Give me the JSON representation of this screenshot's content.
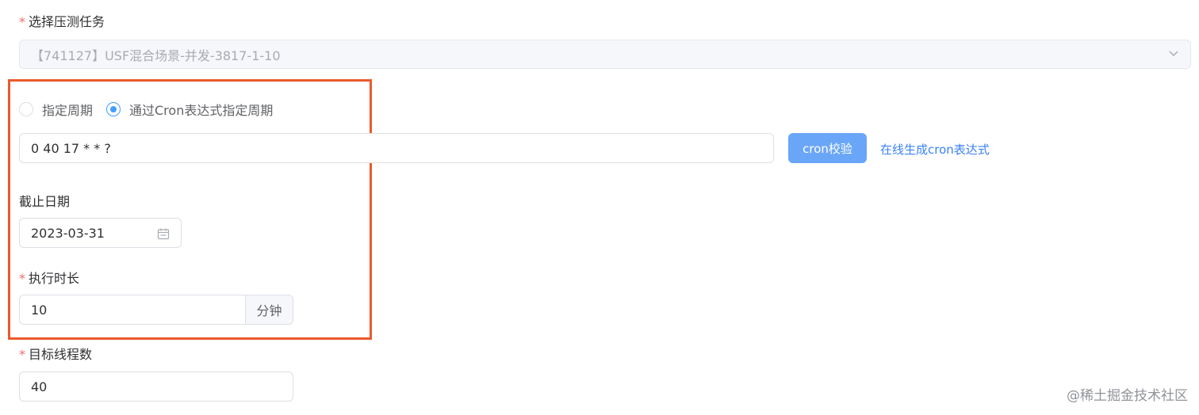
{
  "task": {
    "required_mark": "*",
    "label": "选择压测任务",
    "selected": "【741127】USF混合场景-并发-3817-1-10"
  },
  "schedule": {
    "options": [
      {
        "label": "指定周期",
        "checked": false
      },
      {
        "label": "通过Cron表达式指定周期",
        "checked": true
      }
    ],
    "cron_value": "0 40 17 * * ?",
    "validate_button": "cron校验",
    "generate_link": "在线生成cron表达式"
  },
  "deadline": {
    "label": "截止日期",
    "value": "2023-03-31"
  },
  "duration": {
    "required_mark": "*",
    "label": "执行时长",
    "value": "10",
    "unit": "分钟"
  },
  "threads": {
    "required_mark": "*",
    "label": "目标线程数",
    "value": "40"
  },
  "watermark": "@稀土掘金技术社区",
  "colors": {
    "primary": "#409eff",
    "button": "#6aa6f7",
    "link": "#3b82f6",
    "required": "#f56c6c",
    "highlight_border": "#ea5a2b"
  },
  "icons": [
    "chevron-down-icon",
    "calendar-icon"
  ]
}
